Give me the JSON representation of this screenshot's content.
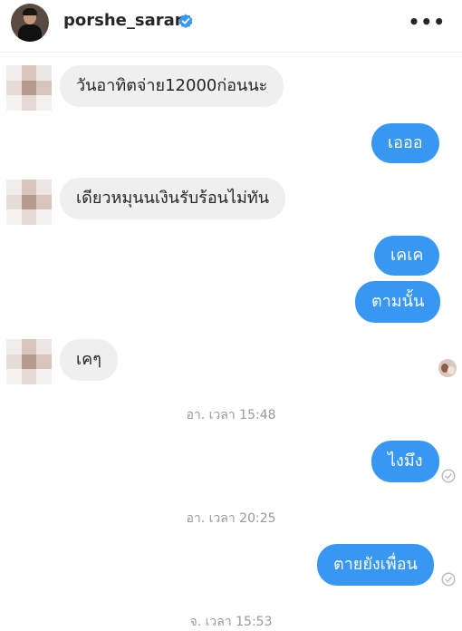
{
  "header": {
    "username": "porshe_saran",
    "verified_icon": "verified-badge-icon",
    "more_icon": "more-horizontal-icon"
  },
  "messages": [
    {
      "id": "m1",
      "sender": "them",
      "text": "วันอาทิตจ่าย12000ก่อนนะ"
    },
    {
      "id": "m2",
      "sender": "me",
      "text": "เอออ"
    },
    {
      "id": "m3",
      "sender": "them",
      "text": "เดียวหมุนนเงินรับร้อนไม่ทัน"
    },
    {
      "id": "m4",
      "sender": "me",
      "text": "เคเค"
    },
    {
      "id": "m5",
      "sender": "me",
      "text": "ตามนั้น"
    },
    {
      "id": "m6",
      "sender": "them",
      "text": "เคๆ"
    },
    {
      "id": "t1",
      "type": "timestamp",
      "text": "อา. เวลา 15:48"
    },
    {
      "id": "m7",
      "sender": "me",
      "text": "ไงมึง"
    },
    {
      "id": "t2",
      "type": "timestamp",
      "text": "อา. เวลา 20:25"
    },
    {
      "id": "m8",
      "sender": "me",
      "text": "ตายยังเพื่อน"
    },
    {
      "id": "t3",
      "type": "timestamp",
      "text": "จ. เวลา 15:53"
    }
  ],
  "colors": {
    "outgoing_bubble": "#3897f0",
    "incoming_bubble": "#efefef",
    "verified": "#3897f0"
  }
}
